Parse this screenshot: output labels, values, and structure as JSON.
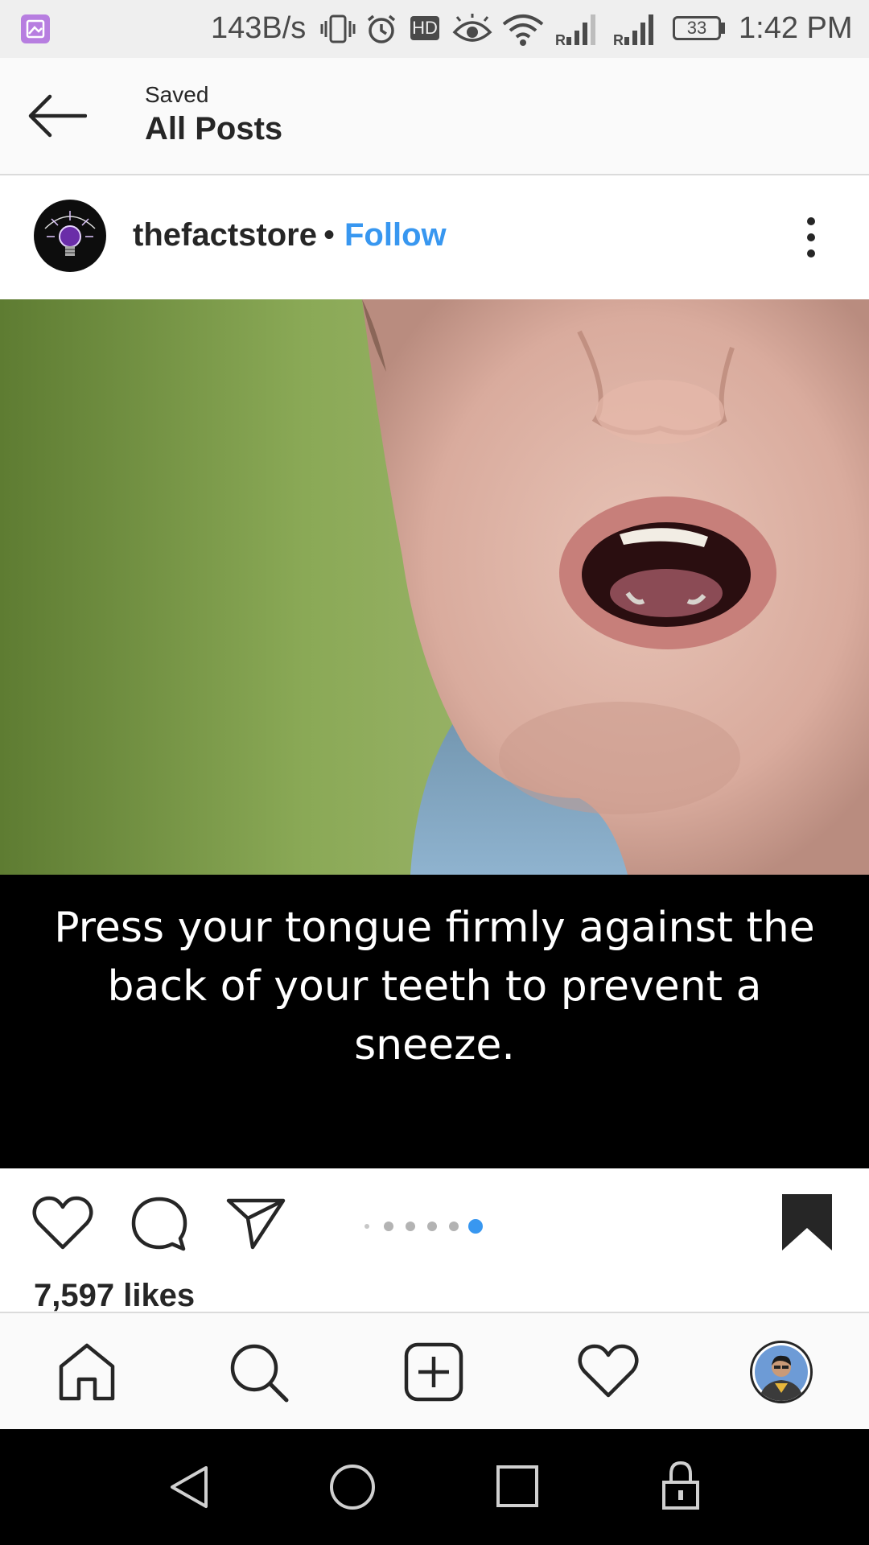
{
  "status_bar": {
    "speed": "143B/s",
    "hd_badge": "HD",
    "battery": "33",
    "time": "1:42 PM"
  },
  "header": {
    "subtitle": "Saved",
    "title": "All Posts"
  },
  "post": {
    "username": "thefactstore",
    "separator": "•",
    "follow_label": "Follow",
    "caption": "Press your tongue firmly against the back of your teeth to prevent a sneeze.",
    "likes": "7,597 likes",
    "carousel": {
      "total": 6,
      "active_index": 5
    }
  },
  "icons": {
    "back": "arrow-left-icon",
    "more": "more-vertical-icon",
    "like": "heart-icon",
    "comment": "comment-icon",
    "share": "send-icon",
    "save": "bookmark-filled-icon",
    "nav": [
      "home-icon",
      "search-icon",
      "add-post-icon",
      "activity-heart-icon",
      "profile-avatar"
    ]
  },
  "colors": {
    "accent": "#3897f0",
    "text": "#262626",
    "caption_bg": "#000000",
    "caption_text": "#ffffff"
  }
}
